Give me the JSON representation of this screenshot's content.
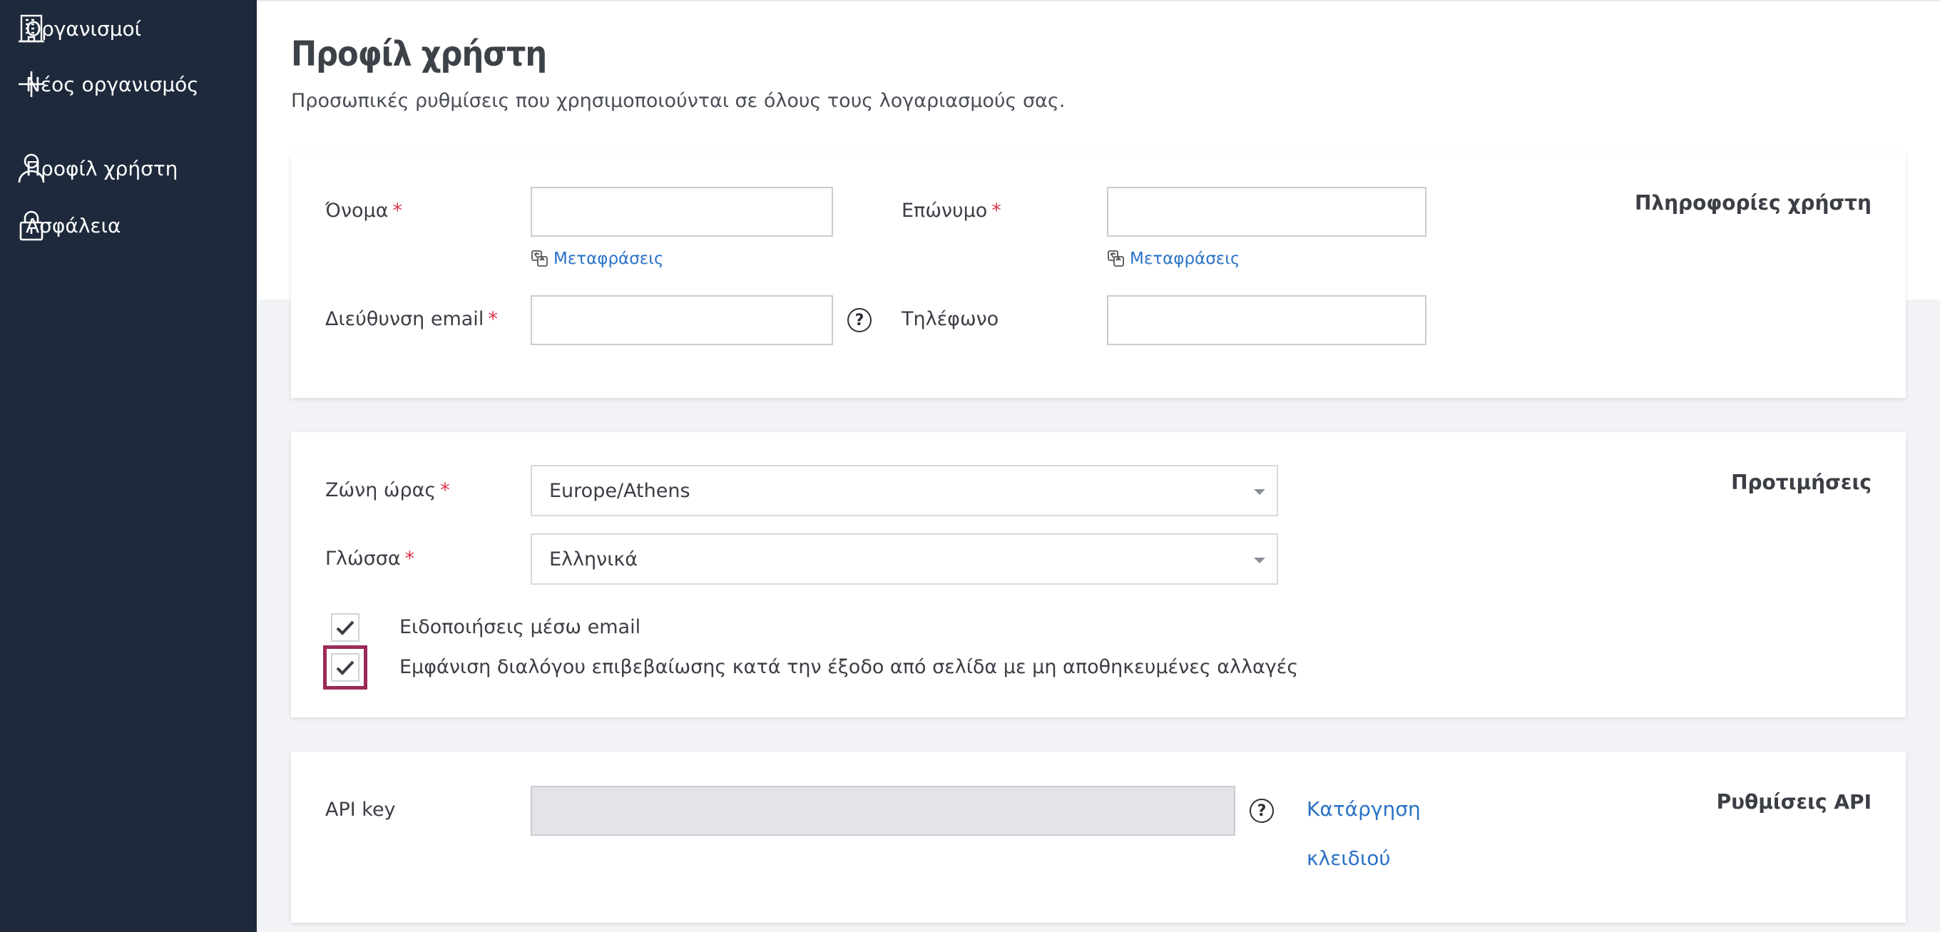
{
  "sidebar": {
    "items": [
      {
        "label": "Οργανισμοί",
        "icon": "building-icon"
      },
      {
        "label": "Νέος οργανισμός",
        "icon": "plus-icon"
      },
      {
        "label": "Προφίλ χρήστη",
        "icon": "user-icon"
      },
      {
        "label": "Ασφάλεια",
        "icon": "lock-icon"
      }
    ]
  },
  "page": {
    "title": "Προφίλ χρήστη",
    "subtitle": "Προσωπικές ρυθμίσεις που χρησιμοποιούνται σε όλους τους λογαριασμούς σας."
  },
  "user_info": {
    "section_title": "Πληροφορίες χρήστη",
    "first_name_label": "Όνομα",
    "first_name_value": "",
    "last_name_label": "Επώνυμο",
    "last_name_value": "",
    "translations_label": "Μεταφράσεις",
    "email_label": "Διεύθυνση email",
    "email_value": "",
    "phone_label": "Τηλέφωνο",
    "phone_value": "",
    "required_mark": "*",
    "help_glyph": "?"
  },
  "preferences": {
    "section_title": "Προτιμήσεις",
    "timezone_label": "Ζώνη ώρας",
    "timezone_value": "Europe/Athens",
    "language_label": "Γλώσσα",
    "language_value": "Ελληνικά",
    "email_notifications_label": "Ειδοποιήσεις μέσω email",
    "email_notifications_checked": true,
    "confirm_dialog_label": "Εμφάνιση διαλόγου επιβεβαίωσης κατά την έξοδο από σελίδα με μη αποθηκευμένες αλλαγές",
    "confirm_dialog_checked": true
  },
  "api": {
    "section_title": "Ρυθμίσεις API",
    "api_key_label": "API key",
    "api_key_value": "",
    "revoke_line1": "Κατάργηση",
    "revoke_line2": "κλειδιού"
  },
  "colors": {
    "sidebar_bg": "#1e2a3b",
    "accent_link": "#2a72c6",
    "required": "#d9344a",
    "focus_outline": "#9c2a5a"
  }
}
